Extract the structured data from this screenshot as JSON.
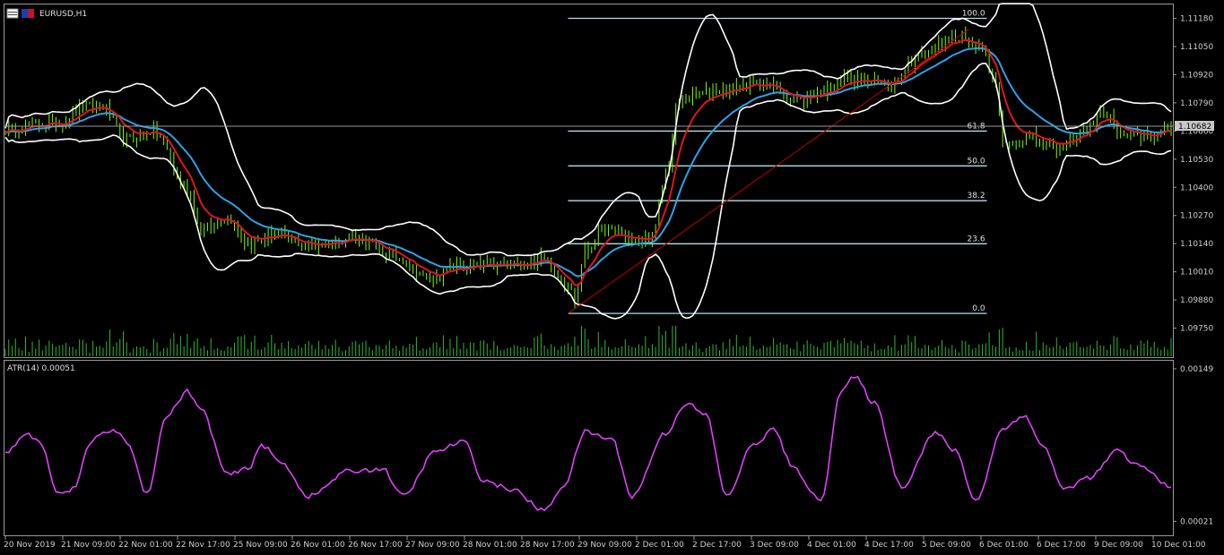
{
  "colors": {
    "background": "#000000",
    "candles": "#7CFC00",
    "bollinger": "#FFFFFF",
    "ma_fast": "#E0141E",
    "ma_slow": "#29A3E8",
    "fibo": "#B0E0E6",
    "trendline": "#C00000",
    "atr": "#E040FB",
    "volume": "#2DB82D",
    "current_price_bg": "#C8C8C8"
  },
  "icons": [
    "chart-window-icon",
    "eurusd-flag-icon"
  ],
  "chart_data": [
    {
      "type": "line",
      "symbol_label": "EURUSD,H1",
      "ylim": [
        1.0962,
        1.1124
      ],
      "y_ticks": [
        "1.11180",
        "1.11050",
        "1.10920",
        "1.10790",
        "1.10660",
        "1.10530",
        "1.10400",
        "1.10270",
        "1.10140",
        "1.10010",
        "1.09880",
        "1.09750"
      ],
      "current_price": "1.10682",
      "x_labels": [
        "20 Nov 2019",
        "21 Nov 09:00",
        "22 Nov 01:00",
        "22 Nov 17:00",
        "25 Nov 09:00",
        "26 Nov 01:00",
        "26 Nov 17:00",
        "27 Nov 09:00",
        "28 Nov 01:00",
        "28 Nov 17:00",
        "29 Nov 09:00",
        "2 Dec 01:00",
        "2 Dec 17:00",
        "3 Dec 09:00",
        "4 Dec 01:00",
        "4 Dec 17:00",
        "5 Dec 09:00",
        "6 Dec 01:00",
        "6 Dec 17:00",
        "9 Dec 09:00",
        "10 Dec 01:00"
      ],
      "price_keypoints": [
        [
          0,
          1.1067
        ],
        [
          16,
          1.107
        ],
        [
          24,
          1.1077
        ],
        [
          28,
          1.1078
        ],
        [
          36,
          1.1062
        ],
        [
          44,
          1.1066
        ],
        [
          54,
          1.104
        ],
        [
          58,
          1.102
        ],
        [
          66,
          1.1026
        ],
        [
          72,
          1.1014
        ],
        [
          80,
          1.1018
        ],
        [
          90,
          1.1013
        ],
        [
          104,
          1.1017
        ],
        [
          116,
          1.1008
        ],
        [
          126,
          1.0998
        ],
        [
          134,
          1.1003
        ],
        [
          150,
          1.1004
        ],
        [
          160,
          1.1007
        ],
        [
          167,
          1.0995
        ],
        [
          169,
          1.0988
        ],
        [
          172,
          1.101
        ],
        [
          178,
          1.1021
        ],
        [
          188,
          1.1015
        ],
        [
          192,
          1.1017
        ],
        [
          196,
          1.1045
        ],
        [
          200,
          1.108
        ],
        [
          212,
          1.1085
        ],
        [
          224,
          1.1088
        ],
        [
          236,
          1.108
        ],
        [
          242,
          1.1084
        ],
        [
          250,
          1.109
        ],
        [
          262,
          1.1088
        ],
        [
          272,
          1.1101
        ],
        [
          282,
          1.111
        ],
        [
          290,
          1.1105
        ],
        [
          294,
          1.1086
        ],
        [
          296,
          1.106
        ],
        [
          304,
          1.1063
        ],
        [
          312,
          1.1058
        ],
        [
          320,
          1.1066
        ],
        [
          326,
          1.1075
        ],
        [
          332,
          1.1063
        ],
        [
          340,
          1.1064
        ],
        [
          346,
          1.1067
        ]
      ],
      "fibonacci": {
        "high": 1.1118,
        "low": 1.09818,
        "levels": [
          {
            "label": "100.0",
            "ratio": 1.0
          },
          {
            "label": "61.8",
            "ratio": 0.618
          },
          {
            "label": "50.0",
            "ratio": 0.5
          },
          {
            "label": "38.2",
            "ratio": 0.382
          },
          {
            "label": "23.6",
            "ratio": 0.236
          },
          {
            "label": "0.0",
            "ratio": 0.0
          }
        ]
      },
      "trendline": {
        "from": [
          167,
          1.09818
        ],
        "to": [
          286,
          1.1113
        ]
      },
      "bollinger_period": 20,
      "ma_fast_period": 8,
      "ma_slow_period": 20,
      "bars_count": 347
    },
    {
      "type": "line",
      "indicator_label": "ATR(14) 0.00051",
      "ylim": [
        0.0001,
        0.00155
      ],
      "y_ticks": [
        "0.00149",
        "0.00021"
      ],
      "atr_keypoints": [
        [
          0,
          0.00078
        ],
        [
          6,
          0.00095
        ],
        [
          10,
          0.00088
        ],
        [
          16,
          0.00044
        ],
        [
          20,
          0.00048
        ],
        [
          26,
          0.0009
        ],
        [
          32,
          0.00098
        ],
        [
          36,
          0.00088
        ],
        [
          42,
          0.00045
        ],
        [
          48,
          0.0011
        ],
        [
          54,
          0.0013
        ],
        [
          58,
          0.00115
        ],
        [
          66,
          0.0006
        ],
        [
          72,
          0.00065
        ],
        [
          76,
          0.00085
        ],
        [
          82,
          0.0007
        ],
        [
          90,
          0.00042
        ],
        [
          102,
          0.00063
        ],
        [
          112,
          0.00065
        ],
        [
          118,
          0.00042
        ],
        [
          128,
          0.0008
        ],
        [
          136,
          0.00088
        ],
        [
          142,
          0.00055
        ],
        [
          150,
          0.00048
        ],
        [
          160,
          0.0003
        ],
        [
          166,
          0.00052
        ],
        [
          172,
          0.00096
        ],
        [
          180,
          0.0009
        ],
        [
          186,
          0.00042
        ],
        [
          196,
          0.00095
        ],
        [
          202,
          0.0012
        ],
        [
          208,
          0.0011
        ],
        [
          214,
          0.00042
        ],
        [
          222,
          0.00085
        ],
        [
          228,
          0.00098
        ],
        [
          234,
          0.00065
        ],
        [
          242,
          0.00038
        ],
        [
          248,
          0.0013
        ],
        [
          252,
          0.00142
        ],
        [
          258,
          0.0012
        ],
        [
          266,
          0.0005
        ],
        [
          276,
          0.00095
        ],
        [
          282,
          0.0008
        ],
        [
          288,
          0.00038
        ],
        [
          296,
          0.00098
        ],
        [
          302,
          0.0011
        ],
        [
          308,
          0.00085
        ],
        [
          314,
          0.00048
        ],
        [
          322,
          0.00058
        ],
        [
          330,
          0.0008
        ],
        [
          336,
          0.00068
        ],
        [
          346,
          0.00051
        ]
      ]
    }
  ]
}
